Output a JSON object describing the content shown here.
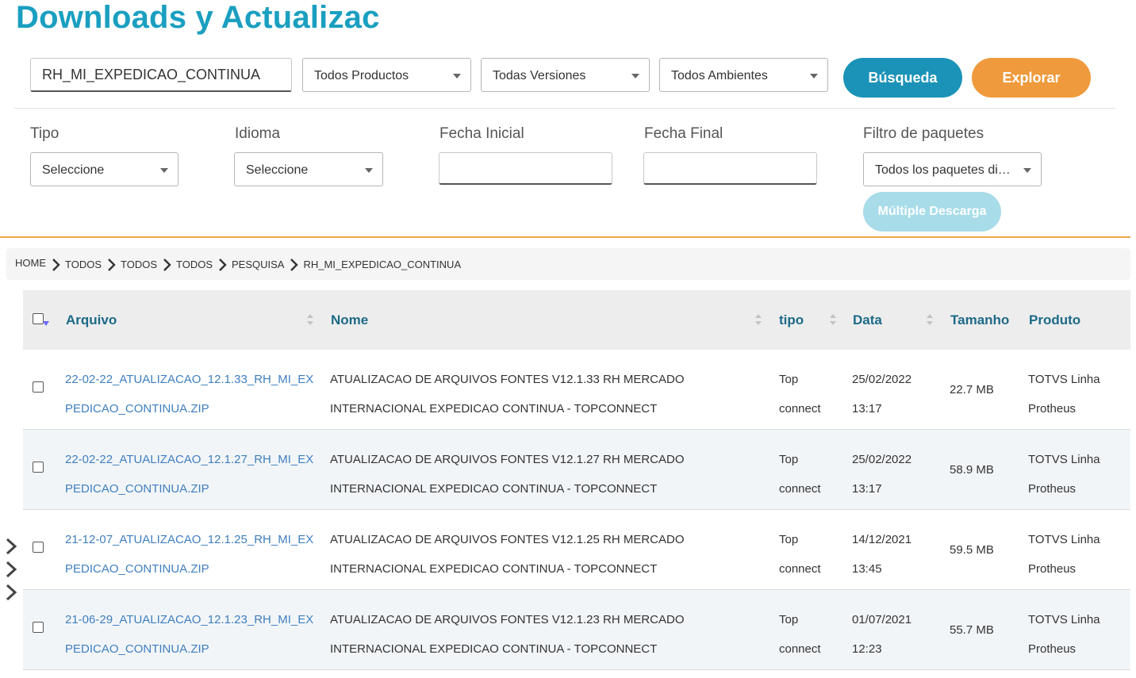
{
  "page": {
    "title": "Downloads y Actualizac"
  },
  "search": {
    "value": "RH_MI_EXPEDICAO_CONTINUA"
  },
  "filters": {
    "products": "Todos Productos",
    "versions": "Todas Versiones",
    "environments": "Todos Ambientes",
    "search_button": "Búsqueda",
    "explore_button": "Explorar",
    "tipo_label": "Tipo",
    "tipo_value": "Seleccione",
    "idioma_label": "Idioma",
    "idioma_value": "Seleccione",
    "fecha_inicial_label": "Fecha Inicial",
    "fecha_final_label": "Fecha Final",
    "paquetes_label": "Filtro de paquetes",
    "paquetes_value": "Todos los paquetes disponibles",
    "multi_button": "Múltiple Descarga"
  },
  "breadcrumb": [
    "HOME",
    "TODOS",
    "TODOS",
    "TODOS",
    "PESQUISA",
    "RH_MI_EXPEDICAO_CONTINUA"
  ],
  "table": {
    "headers": {
      "arquivo": "Arquivo",
      "nome": "Nome",
      "tipo": "tipo",
      "data": "Data",
      "tamanho": "Tamanho",
      "produto": "Produto"
    },
    "rows": [
      {
        "file1": "22-02-22_ATUALIZACAO_12.1.33_RH_MI_EX",
        "file2": "PEDICAO_CONTINUA.ZIP",
        "name1": "ATUALIZACAO DE ARQUIVOS FONTES V12.1.33 RH MERCADO",
        "name2": "INTERNACIONAL EXPEDICAO CONTINUA - TOPCONNECT",
        "type1": "Top",
        "type2": "connect",
        "date1": "25/02/2022",
        "date2": "13:17",
        "size": "22.7 MB",
        "prod1": "TOTVS Linha",
        "prod2": "Protheus"
      },
      {
        "file1": "22-02-22_ATUALIZACAO_12.1.27_RH_MI_EX",
        "file2": "PEDICAO_CONTINUA.ZIP",
        "name1": "ATUALIZACAO DE ARQUIVOS FONTES V12.1.27 RH MERCADO",
        "name2": "INTERNACIONAL EXPEDICAO CONTINUA - TOPCONNECT",
        "type1": "Top",
        "type2": "connect",
        "date1": "25/02/2022",
        "date2": "13:17",
        "size": "58.9 MB",
        "prod1": "TOTVS Linha",
        "prod2": "Protheus"
      },
      {
        "file1": "21-12-07_ATUALIZACAO_12.1.25_RH_MI_EX",
        "file2": "PEDICAO_CONTINUA.ZIP",
        "name1": "ATUALIZACAO DE ARQUIVOS FONTES V12.1.25 RH MERCADO",
        "name2": "INTERNACIONAL EXPEDICAO CONTINUA - TOPCONNECT",
        "type1": "Top",
        "type2": "connect",
        "date1": "14/12/2021",
        "date2": "13:45",
        "size": "59.5 MB",
        "prod1": "TOTVS Linha",
        "prod2": "Protheus"
      },
      {
        "file1": "21-06-29_ATUALIZACAO_12.1.23_RH_MI_EX",
        "file2": "PEDICAO_CONTINUA.ZIP",
        "name1": "ATUALIZACAO DE ARQUIVOS FONTES V12.1.23 RH MERCADO",
        "name2": "INTERNACIONAL EXPEDICAO CONTINUA - TOPCONNECT",
        "type1": "Top",
        "type2": "connect",
        "date1": "01/07/2021",
        "date2": "12:23",
        "size": "55.7 MB",
        "prod1": "TOTVS Linha",
        "prod2": "Protheus"
      }
    ]
  },
  "colors": {
    "title": "#1a9fc0",
    "search_button": "#1b93b8",
    "explore_button": "#ef9a3c",
    "multi_button": "#a8dce9",
    "link": "#3f7fbf",
    "header_text": "#1d6a87",
    "divider": "#efa544"
  }
}
